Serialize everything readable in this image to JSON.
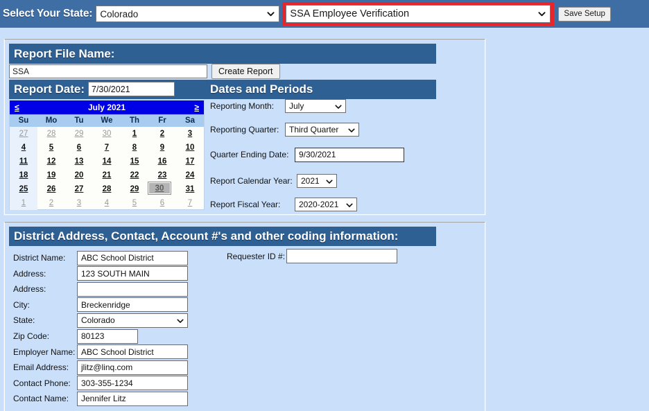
{
  "topbar": {
    "state_label": "Select Your State:",
    "state_value": "Colorado",
    "module_value": "SSA Employee Verification",
    "save_label": "Save Setup",
    "highlight_color": "#e8252a"
  },
  "report_panel": {
    "header": "Report File Name:",
    "file_name_value": "SSA",
    "create_report_label": "Create Report",
    "report_date_label": "Report Date:",
    "report_date_value": "7/30/2021",
    "dates_periods_title": "Dates and Periods"
  },
  "calendar": {
    "prev_label": "≤",
    "next_label": "≥",
    "title": "July 2021",
    "dow": [
      "Su",
      "Mo",
      "Tu",
      "We",
      "Th",
      "Fr",
      "Sa"
    ],
    "selected_day": 30,
    "weeks": [
      [
        {
          "d": "27",
          "other": true
        },
        {
          "d": "28",
          "other": true
        },
        {
          "d": "29",
          "other": true
        },
        {
          "d": "30",
          "other": true
        },
        {
          "d": "1"
        },
        {
          "d": "2"
        },
        {
          "d": "3"
        }
      ],
      [
        {
          "d": "4"
        },
        {
          "d": "5"
        },
        {
          "d": "6"
        },
        {
          "d": "7"
        },
        {
          "d": "8"
        },
        {
          "d": "9"
        },
        {
          "d": "10"
        }
      ],
      [
        {
          "d": "11"
        },
        {
          "d": "12"
        },
        {
          "d": "13"
        },
        {
          "d": "14"
        },
        {
          "d": "15"
        },
        {
          "d": "16"
        },
        {
          "d": "17"
        }
      ],
      [
        {
          "d": "18"
        },
        {
          "d": "19"
        },
        {
          "d": "20"
        },
        {
          "d": "21"
        },
        {
          "d": "22"
        },
        {
          "d": "23"
        },
        {
          "d": "24"
        }
      ],
      [
        {
          "d": "25"
        },
        {
          "d": "26"
        },
        {
          "d": "27"
        },
        {
          "d": "28"
        },
        {
          "d": "29"
        },
        {
          "d": "30",
          "sel": true
        },
        {
          "d": "31"
        }
      ],
      [
        {
          "d": "1",
          "other": true
        },
        {
          "d": "2",
          "other": true
        },
        {
          "d": "3",
          "other": true
        },
        {
          "d": "4",
          "other": true
        },
        {
          "d": "5",
          "other": true
        },
        {
          "d": "6",
          "other": true
        },
        {
          "d": "7",
          "other": true
        }
      ]
    ]
  },
  "dates_periods": {
    "reporting_month_label": "Reporting Month:",
    "reporting_month_value": "July",
    "reporting_quarter_label": "Reporting Quarter:",
    "reporting_quarter_value": "Third Quarter",
    "quarter_ending_label": "Quarter Ending Date:",
    "quarter_ending_value": "9/30/2021",
    "calendar_year_label": "Report Calendar Year:",
    "calendar_year_value": "2021",
    "fiscal_year_label": "Report Fiscal Year:",
    "fiscal_year_value": "2020-2021"
  },
  "district_panel": {
    "header": "District Address, Contact, Account #'s and other coding information:",
    "requester_label": "Requester ID #:",
    "requester_value": "",
    "fields": [
      {
        "label": "District Name:",
        "value": "ABC School District",
        "type": "text"
      },
      {
        "label": "Address:",
        "value": "123 SOUTH MAIN",
        "type": "text"
      },
      {
        "label": "Address:",
        "value": "",
        "type": "text"
      },
      {
        "label": "City:",
        "value": "Breckenridge",
        "type": "text"
      },
      {
        "label": "State:",
        "value": "Colorado",
        "type": "dropdown"
      },
      {
        "label": "Zip Code:",
        "value": "80123",
        "type": "text-short"
      },
      {
        "label": "Employer Name:",
        "value": "ABC School District",
        "type": "text"
      },
      {
        "label": "Email Address:",
        "value": "jlitz@linq.com",
        "type": "text"
      },
      {
        "label": "Contact Phone:",
        "value": "303-355-1234",
        "type": "text"
      },
      {
        "label": "Contact Name:",
        "value": "Jennifer Litz",
        "type": "text"
      }
    ]
  },
  "colors": {
    "page_background": "#c9dffa",
    "topbar_blue": "#3f6ea5",
    "panel_header_blue": "#2f6094",
    "calendar_header_blue": "#0000e6"
  }
}
